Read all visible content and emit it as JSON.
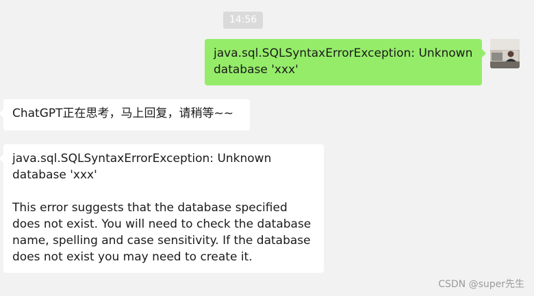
{
  "chat": {
    "timestamp": "14:56",
    "sent_message": "java.sql.SQLSyntaxErrorException: Unknown database 'xxx'",
    "reply_1": "ChatGPT正在思考，马上回复，请稍等~~",
    "reply_2_line1": "java.sql.SQLSyntaxErrorException: Unknown database 'xxx'",
    "reply_2_line2": "This error suggests that the database specified does not exist. You will need to check the database name, spelling and case sensitivity. If the database does not exist you may need to create it."
  },
  "watermark": "CSDN @super先生",
  "colors": {
    "background": "#f2f2f2",
    "sent_bubble": "#95ec69",
    "received_bubble": "#ffffff",
    "timestamp_bg": "#dadada"
  }
}
